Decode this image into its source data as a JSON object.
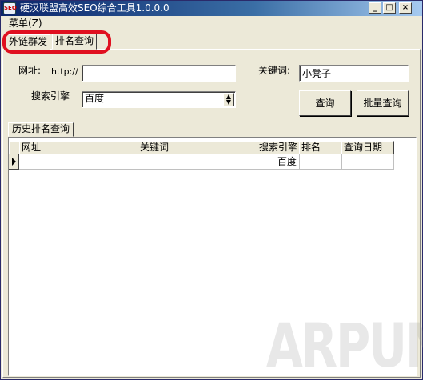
{
  "window": {
    "title": "硬汉联盟高效SEO综合工具1.0.0.0",
    "app_icon_text": "SEO",
    "controls": {
      "minimize": "_",
      "maximize": "□",
      "close": "×"
    }
  },
  "menu": {
    "items": [
      {
        "label": "菜单(Z)"
      }
    ]
  },
  "tabs": [
    {
      "label": "外链群发",
      "active": false
    },
    {
      "label": "排名查询",
      "active": true
    }
  ],
  "highlight_color": "#e01020",
  "form": {
    "url_label": "网址:",
    "url_prefix": "http://",
    "url_value": "",
    "keyword_label": "关键词:",
    "keyword_value": "小凳子",
    "engine_label": "搜索引擎",
    "engine_selected": "百度",
    "query_button": "查询",
    "batch_button": "批量查询"
  },
  "history": {
    "tab_label": "历史排名查询",
    "columns": [
      "网址",
      "关键词",
      "搜索引擎",
      "排名",
      "查询日期"
    ],
    "rows": [
      {
        "url": "",
        "keyword": "",
        "engine": "百度",
        "rank": "",
        "date": ""
      }
    ]
  },
  "watermark": "ARPUN"
}
